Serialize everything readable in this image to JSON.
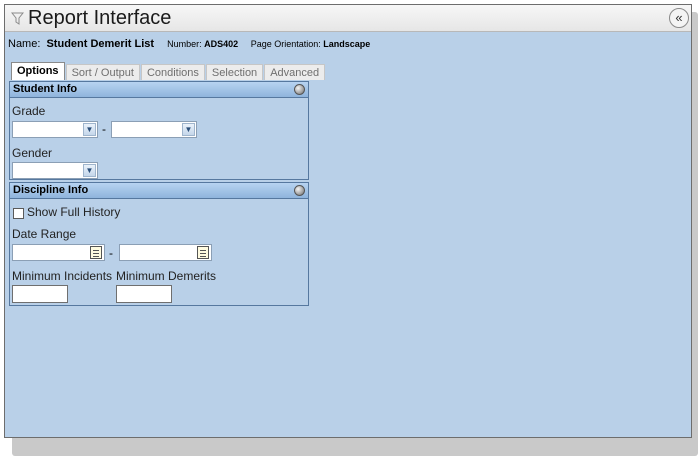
{
  "window": {
    "title": "Report Interface",
    "collapse_label": "«"
  },
  "report": {
    "name_label": "Name:",
    "name_value": "Student Demerit List",
    "number_label": "Number:",
    "number_value": "ADS402",
    "orientation_label": "Page Orientation:",
    "orientation_value": "Landscape"
  },
  "tabs": [
    {
      "label": "Options",
      "active": true
    },
    {
      "label": "Sort / Output",
      "active": false
    },
    {
      "label": "Conditions",
      "active": false
    },
    {
      "label": "Selection",
      "active": false
    },
    {
      "label": "Advanced",
      "active": false
    }
  ],
  "student_info": {
    "header": "Student Info",
    "grade_label": "Grade",
    "grade_from": "",
    "grade_to": "",
    "range_separator": "-",
    "gender_label": "Gender",
    "gender_value": ""
  },
  "discipline_info": {
    "header": "Discipline Info",
    "show_full_history_label": "Show Full History",
    "show_full_history_checked": false,
    "date_range_label": "Date Range",
    "date_from": "",
    "date_to": "",
    "range_separator": "-",
    "min_incidents_label": "Minimum Incidents",
    "min_incidents_value": "",
    "min_demerits_label": "Minimum Demerits",
    "min_demerits_value": ""
  },
  "colors": {
    "background": "#b9d0e8",
    "panel_header": "#a3c4e7",
    "border": "#56789f"
  }
}
